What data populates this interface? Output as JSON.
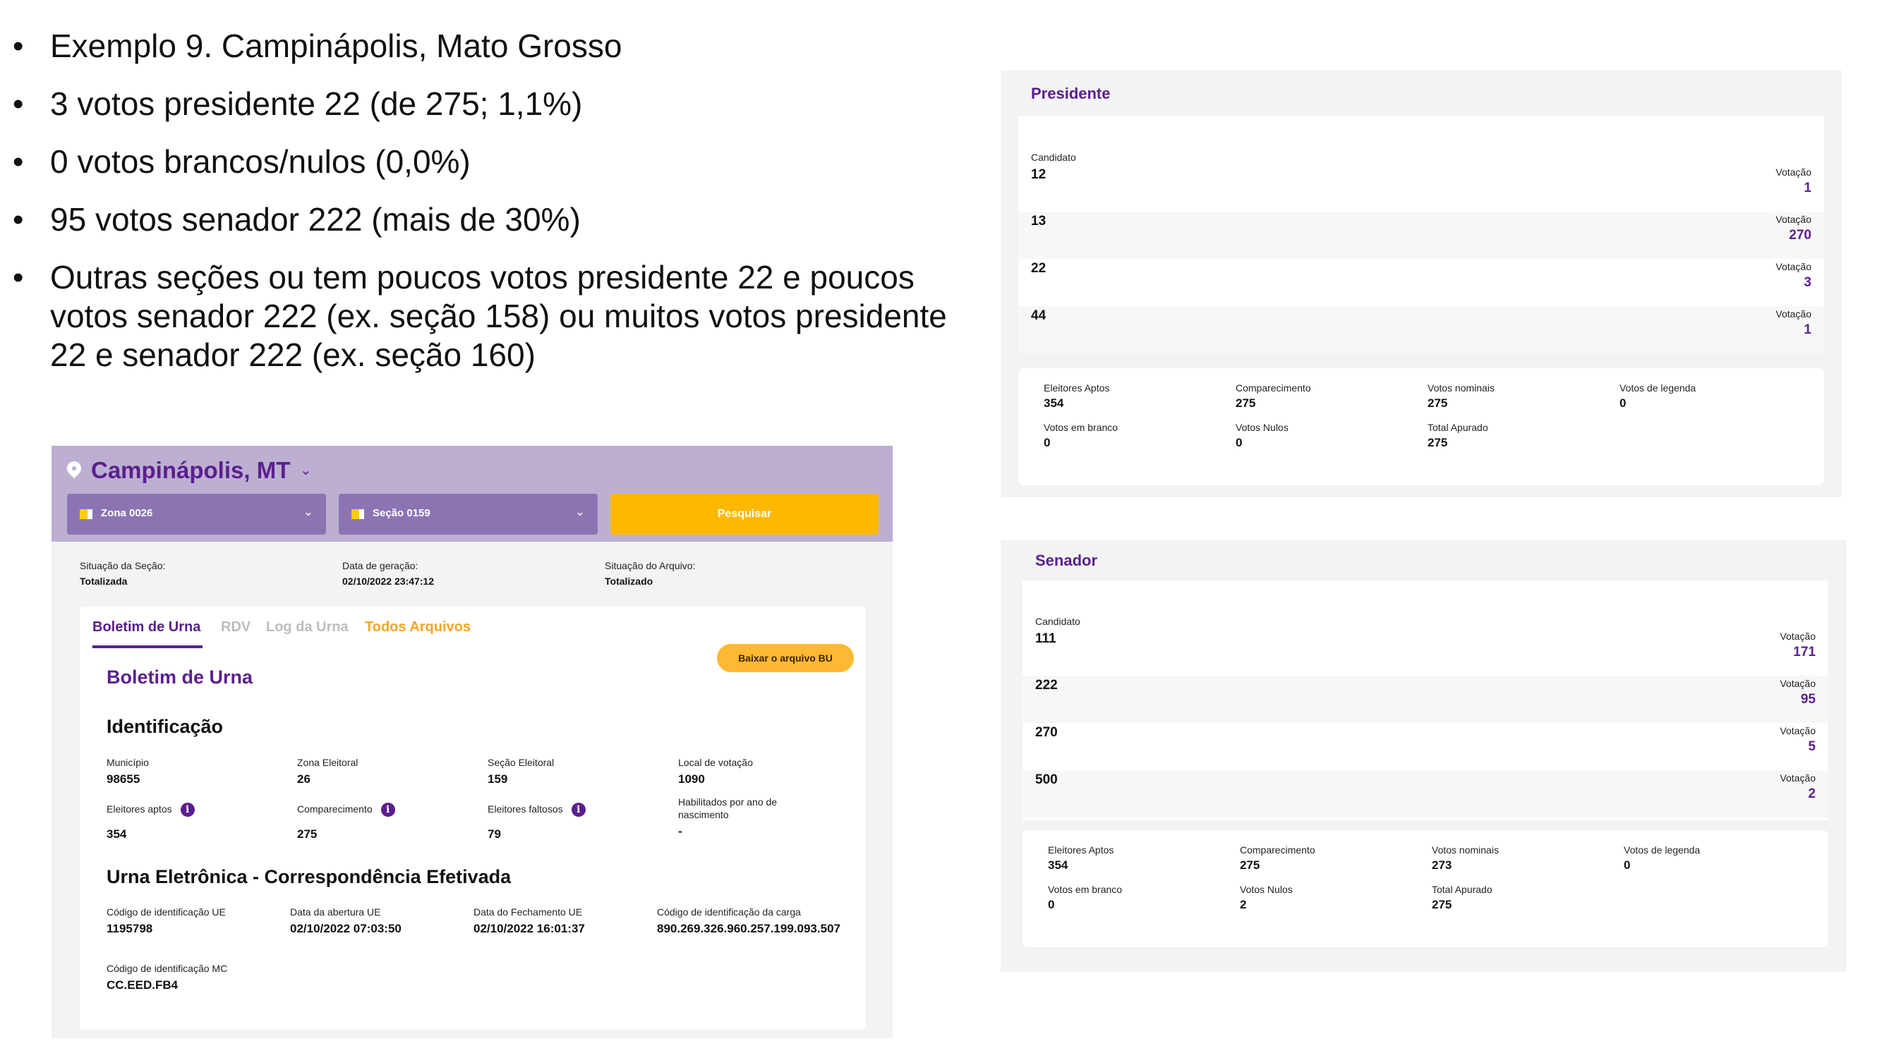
{
  "bullets": [
    "Exemplo 9. Campinápolis, Mato Grosso",
    "3 votos presidente 22 (de 275; 1,1%)",
    "0 votos brancos/nulos (0,0%)",
    "95 votos senador 222 (mais de 30%)",
    "Outras seções ou tem poucos votos presidente 22 e poucos votos senador 222 (ex. seção 158) ou muitos votos presidente 22 e senador 222 (ex. seção 160)"
  ],
  "screen": {
    "city": "Campinápolis, MT",
    "zona_select": "Zona 0026",
    "secao_select": "Seção 0159",
    "search_label": "Pesquisar",
    "status": [
      {
        "label": "Situação da Seção:",
        "value": "Totalizada"
      },
      {
        "label": "Data de geração:",
        "value": "02/10/2022 23:47:12"
      },
      {
        "label": "Situação do Arquivo:",
        "value": "Totalizado"
      }
    ],
    "tabs": [
      "Boletim de Urna",
      "RDV",
      "Log da Urna",
      "Todos Arquivos"
    ],
    "download_label": "Baixar o arquivo BU",
    "section_title": "Boletim de Urna",
    "identificacao_title": "Identificação",
    "identificacao": [
      {
        "label": "Município",
        "value": "98655"
      },
      {
        "label": "Zona Eleitoral",
        "value": "26"
      },
      {
        "label": "Seção Eleitoral",
        "value": "159"
      },
      {
        "label": "Local de votação",
        "value": "1090"
      },
      {
        "label": "Eleitores aptos",
        "value": "354"
      },
      {
        "label": "Comparecimento",
        "value": "275"
      },
      {
        "label": "Eleitores faltosos",
        "value": "79"
      },
      {
        "label": "Habilitados por ano de nascimento",
        "value": "-"
      }
    ],
    "urna_title": "Urna Eletrônica - Correspondência Efetivada",
    "urna": [
      {
        "label": "Código de identificação UE",
        "value": "1195798"
      },
      {
        "label": "Data da abertura UE",
        "value": "02/10/2022 07:03:50"
      },
      {
        "label": "Data do Fechamento UE",
        "value": "02/10/2022 16:01:37"
      },
      {
        "label": "Código de identificação da carga",
        "value": "890.269.326.960.257.199.093.507"
      },
      {
        "label": "Código de identificação MC",
        "value": "CC.EED.FB4"
      }
    ]
  },
  "presidente": {
    "title": "Presidente",
    "candidato_label": "Candidato",
    "votacao_label": "Votação",
    "rows": [
      {
        "candidato": "12",
        "votos": "1"
      },
      {
        "candidato": "13",
        "votos": "270"
      },
      {
        "candidato": "22",
        "votos": "3"
      },
      {
        "candidato": "44",
        "votos": "1"
      }
    ],
    "summary": [
      {
        "label": "Eleitores Aptos",
        "value": "354"
      },
      {
        "label": "Comparecimento",
        "value": "275"
      },
      {
        "label": "Votos nominais",
        "value": "275"
      },
      {
        "label": "Votos de legenda",
        "value": "0"
      },
      {
        "label": "Votos em branco",
        "value": "0"
      },
      {
        "label": "Votos Nulos",
        "value": "0"
      },
      {
        "label": "Total Apurado",
        "value": "275"
      }
    ]
  },
  "senador": {
    "title": "Senador",
    "candidato_label": "Candidato",
    "votacao_label": "Votação",
    "rows": [
      {
        "candidato": "111",
        "votos": "171"
      },
      {
        "candidato": "222",
        "votos": "95"
      },
      {
        "candidato": "270",
        "votos": "5"
      },
      {
        "candidato": "500",
        "votos": "2"
      }
    ],
    "summary": [
      {
        "label": "Eleitores Aptos",
        "value": "354"
      },
      {
        "label": "Comparecimento",
        "value": "275"
      },
      {
        "label": "Votos nominais",
        "value": "273"
      },
      {
        "label": "Votos de legenda",
        "value": "0"
      },
      {
        "label": "Votos em branco",
        "value": "0"
      },
      {
        "label": "Votos Nulos",
        "value": "2"
      },
      {
        "label": "Total Apurado",
        "value": "275"
      }
    ]
  },
  "colors": {
    "purple": "#5b1f8e",
    "header": "#bcafd2",
    "select": "#8c74b3",
    "accent": "#ffb800"
  }
}
